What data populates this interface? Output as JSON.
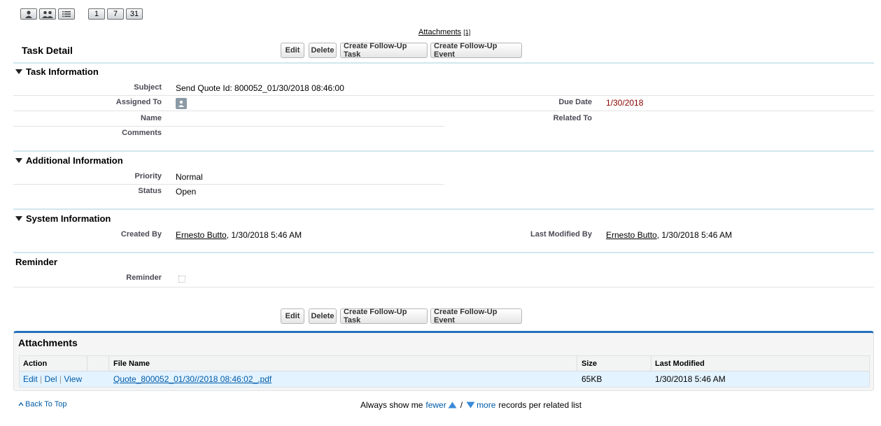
{
  "toolbar": {
    "view_buttons": [
      "person-icon",
      "people-icon",
      "list-icon"
    ],
    "calendar_buttons": [
      "1",
      "7",
      "31"
    ]
  },
  "attachments_link": {
    "label": "Attachments",
    "count": "[1]"
  },
  "task_detail": {
    "title": "Task Detail",
    "buttons": {
      "edit": "Edit",
      "delete": "Delete",
      "follow_up_task": "Create Follow-Up Task",
      "follow_up_event": "Create Follow-Up Event"
    }
  },
  "task_information": {
    "heading": "Task Information",
    "subject_label": "Subject",
    "subject_value": "Send Quote Id: 800052_01/30/2018 08:46:00",
    "assigned_to_label": "Assigned To",
    "due_date_label": "Due Date",
    "due_date_value": "1/30/2018",
    "name_label": "Name",
    "related_to_label": "Related To",
    "comments_label": "Comments"
  },
  "additional_information": {
    "heading": "Additional Information",
    "priority_label": "Priority",
    "priority_value": "Normal",
    "status_label": "Status",
    "status_value": "Open"
  },
  "system_information": {
    "heading": "System Information",
    "created_by_label": "Created By",
    "created_by_user": "Ernesto Butto",
    "created_by_date": ", 1/30/2018 5:46 AM",
    "last_modified_label": "Last Modified By",
    "last_modified_user": "Ernesto Butto",
    "last_modified_date": ", 1/30/2018 5:46 AM"
  },
  "reminder": {
    "heading": "Reminder",
    "label": "Reminder",
    "checked": false
  },
  "attachments": {
    "title": "Attachments",
    "columns": {
      "action": "Action",
      "file_name": "File Name",
      "size": "Size",
      "last_modified": "Last Modified"
    },
    "rows": [
      {
        "edit": "Edit",
        "del": "Del",
        "view": "View",
        "sep": "|",
        "file_name": "Quote_800052_01/30//2018 08:46:02_.pdf",
        "size": "65KB",
        "last_modified": "1/30/2018 5:46 AM"
      }
    ]
  },
  "footer": {
    "back_to_top": "Back To Top",
    "always_show": "Always show me",
    "fewer": "fewer",
    "slash": "/",
    "more": "more",
    "records_text": "records per related list"
  },
  "colors": {
    "accent": "#236fbd",
    "divider": "#d1e6ef",
    "due_date": "#8b0000",
    "link_blue": "#015ba7"
  }
}
